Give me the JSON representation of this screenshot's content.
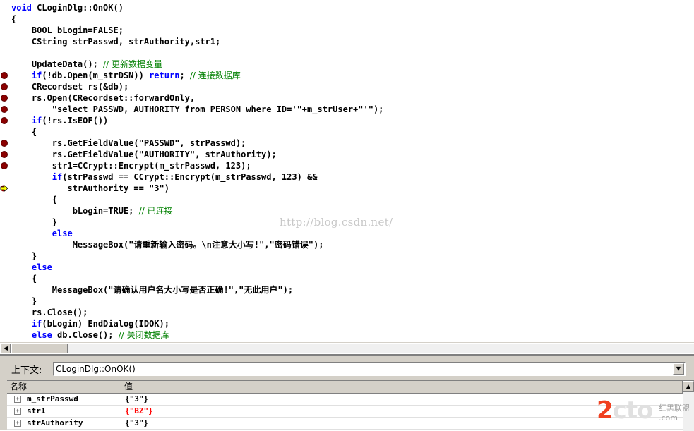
{
  "editor": {
    "lines": [
      {
        "text": "void CLoginDlg::OnOK()"
      },
      {
        "text": "{"
      },
      {
        "text": "    BOOL bLogin=FALSE;"
      },
      {
        "text": "    CString strPasswd, strAuthority,str1;"
      },
      {
        "text": ""
      },
      {
        "text": "    UpdateData(); ",
        "comment": "// 更新数据变量"
      },
      {
        "text": "    if(!db.Open(m_strDSN)) return; ",
        "comment": "// 连接数据库"
      },
      {
        "text": "    CRecordset rs(&db);"
      },
      {
        "text": "    rs.Open(CRecordset::forwardOnly,"
      },
      {
        "text": "        \"select PASSWD, AUTHORITY from PERSON where ID='\"+m_strUser+\"'\");"
      },
      {
        "text": "    if(!rs.IsEOF())"
      },
      {
        "text": "    {"
      },
      {
        "text": "        rs.GetFieldValue(\"PASSWD\", strPasswd);"
      },
      {
        "text": "        rs.GetFieldValue(\"AUTHORITY\", strAuthority);"
      },
      {
        "text": "        str1=CCrypt::Encrypt(m_strPasswd, 123);"
      },
      {
        "text": "        if(strPasswd == CCrypt::Encrypt(m_strPasswd, 123) &&"
      },
      {
        "text": "           strAuthority == \"3\")"
      },
      {
        "text": "        {"
      },
      {
        "text": "            bLogin=TRUE; ",
        "comment": "// 已连接"
      },
      {
        "text": "        }"
      },
      {
        "text": "        else"
      },
      {
        "text": "            MessageBox(\"请重新输入密码。\\n注意大小写!\",\"密码错误\");"
      },
      {
        "text": "    }"
      },
      {
        "text": "    else"
      },
      {
        "text": "    {"
      },
      {
        "text": "        MessageBox(\"请确认用户名大小写是否正确!\",\"无此用户\");"
      },
      {
        "text": "    }"
      },
      {
        "text": "    rs.Close();"
      },
      {
        "text": "    if(bLogin) EndDialog(IDOK);"
      },
      {
        "text": "    else db.Close(); ",
        "comment": "// 关闭数据库"
      }
    ],
    "breakpoint_lines": [
      6,
      7,
      8,
      9,
      10,
      12,
      13,
      14
    ],
    "current_line": 16,
    "watermark": "http://blog.csdn.net/"
  },
  "context": {
    "label": "上下文:",
    "value": "CLoginDlg::OnOK()"
  },
  "watch": {
    "headers": [
      "名称",
      "值"
    ],
    "rows": [
      {
        "name": "m_strPasswd",
        "value": "{\"3\"}",
        "changed": false
      },
      {
        "name": "str1",
        "value": "{\"BZ\"}",
        "changed": true
      },
      {
        "name": "strAuthority",
        "value": "{\"3\"}",
        "changed": false
      }
    ]
  },
  "logo": {
    "main": "2cto",
    "cn": "红黑联盟",
    "url": ".com"
  },
  "colors": {
    "keyword": "#0000ff",
    "comment": "#008000",
    "breakpoint": "#8b0000",
    "changed_value": "#ff0000"
  }
}
